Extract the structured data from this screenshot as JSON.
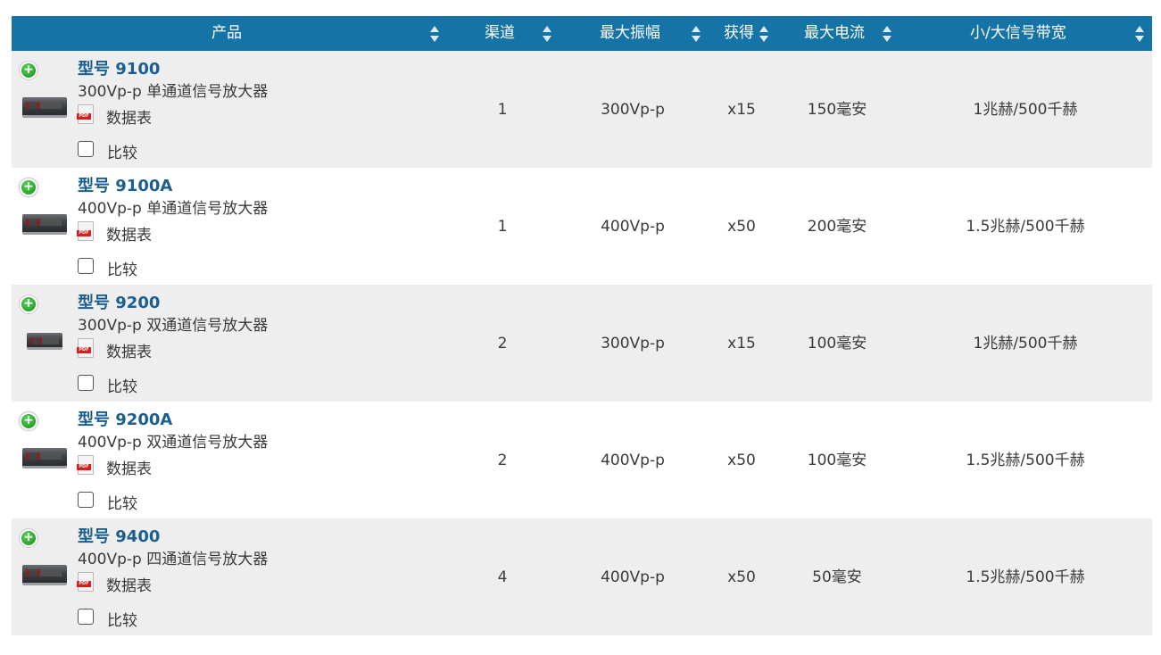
{
  "header": {
    "product": "产品",
    "channels": "渠道",
    "max_amplitude": "最大振幅",
    "gain": "获得",
    "max_current": "最大电流",
    "bandwidth": "小/大信号带宽"
  },
  "common": {
    "datasheet_label": "数据表",
    "compare_label": "比较",
    "pdf_tag": "PDF",
    "add_symbol": "+"
  },
  "rows": [
    {
      "model": "型号 9100",
      "description": "300Vp-p 单通道信号放大器",
      "channels": "1",
      "max_amplitude": "300Vp-p",
      "gain": "x15",
      "max_current": "150毫安",
      "bandwidth": "1兆赫/500千赫"
    },
    {
      "model": "型号 9100A",
      "description": "400Vp-p 单通道信号放大器",
      "channels": "1",
      "max_amplitude": "400Vp-p",
      "gain": "x50",
      "max_current": "200毫安",
      "bandwidth": "1.5兆赫/500千赫"
    },
    {
      "model": "型号 9200",
      "description": "300Vp-p 双通道信号放大器",
      "channels": "2",
      "max_amplitude": "300Vp-p",
      "gain": "x15",
      "max_current": "100毫安",
      "bandwidth": "1兆赫/500千赫"
    },
    {
      "model": "型号 9200A",
      "description": "400Vp-p 双通道信号放大器",
      "channels": "2",
      "max_amplitude": "400Vp-p",
      "gain": "x50",
      "max_current": "100毫安",
      "bandwidth": "1.5兆赫/500千赫"
    },
    {
      "model": "型号 9400",
      "description": "400Vp-p 四通道信号放大器",
      "channels": "4",
      "max_amplitude": "400Vp-p",
      "gain": "x50",
      "max_current": "50毫安",
      "bandwidth": "1.5兆赫/500千赫"
    }
  ],
  "colors": {
    "header_bg": "#1673a6",
    "link": "#1b5e91",
    "row_alt": "#eeeeee"
  }
}
